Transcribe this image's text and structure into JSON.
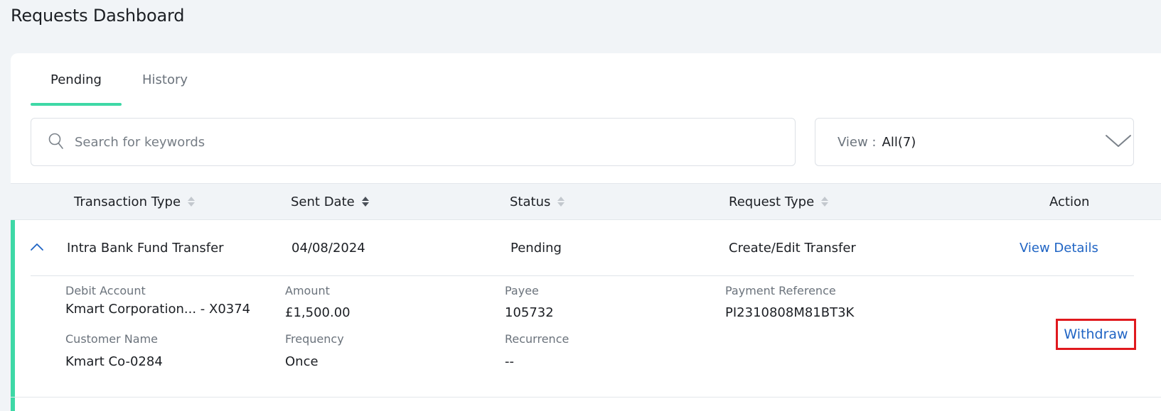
{
  "page": {
    "title": "Requests Dashboard"
  },
  "tabs": [
    {
      "label": "Pending",
      "active": true
    },
    {
      "label": "History",
      "active": false
    }
  ],
  "search": {
    "placeholder": "Search for keywords",
    "value": ""
  },
  "view_filter": {
    "label": "View :",
    "value": "All(7)"
  },
  "table": {
    "columns": [
      "Transaction Type",
      "Sent Date",
      "Status",
      "Request Type",
      "Action"
    ],
    "rows": [
      {
        "transaction_type": "Intra Bank Fund Transfer",
        "sent_date": "04/08/2024",
        "status": "Pending",
        "request_type": "Create/Edit Transfer",
        "action": "View Details",
        "expanded": true,
        "details": {
          "debit_account": {
            "label": "Debit Account",
            "value": "Kmart Corporation... - X0374"
          },
          "amount": {
            "label": "Amount",
            "value": "£1,500.00"
          },
          "payee": {
            "label": "Payee",
            "value": "105732"
          },
          "payment_reference": {
            "label": "Payment Reference",
            "value": "PI2310808M81BT3K"
          },
          "customer_name": {
            "label": "Customer Name",
            "value": "Kmart Co-0284"
          },
          "frequency": {
            "label": "Frequency",
            "value": "Once"
          },
          "recurrence": {
            "label": "Recurrence",
            "value": "--"
          },
          "withdraw_label": "Withdraw"
        }
      }
    ]
  },
  "colors": {
    "accent": "#3ed8a6",
    "link": "#1f64c4",
    "highlight_box": "#e0191e",
    "background": "#f1f4f7"
  }
}
